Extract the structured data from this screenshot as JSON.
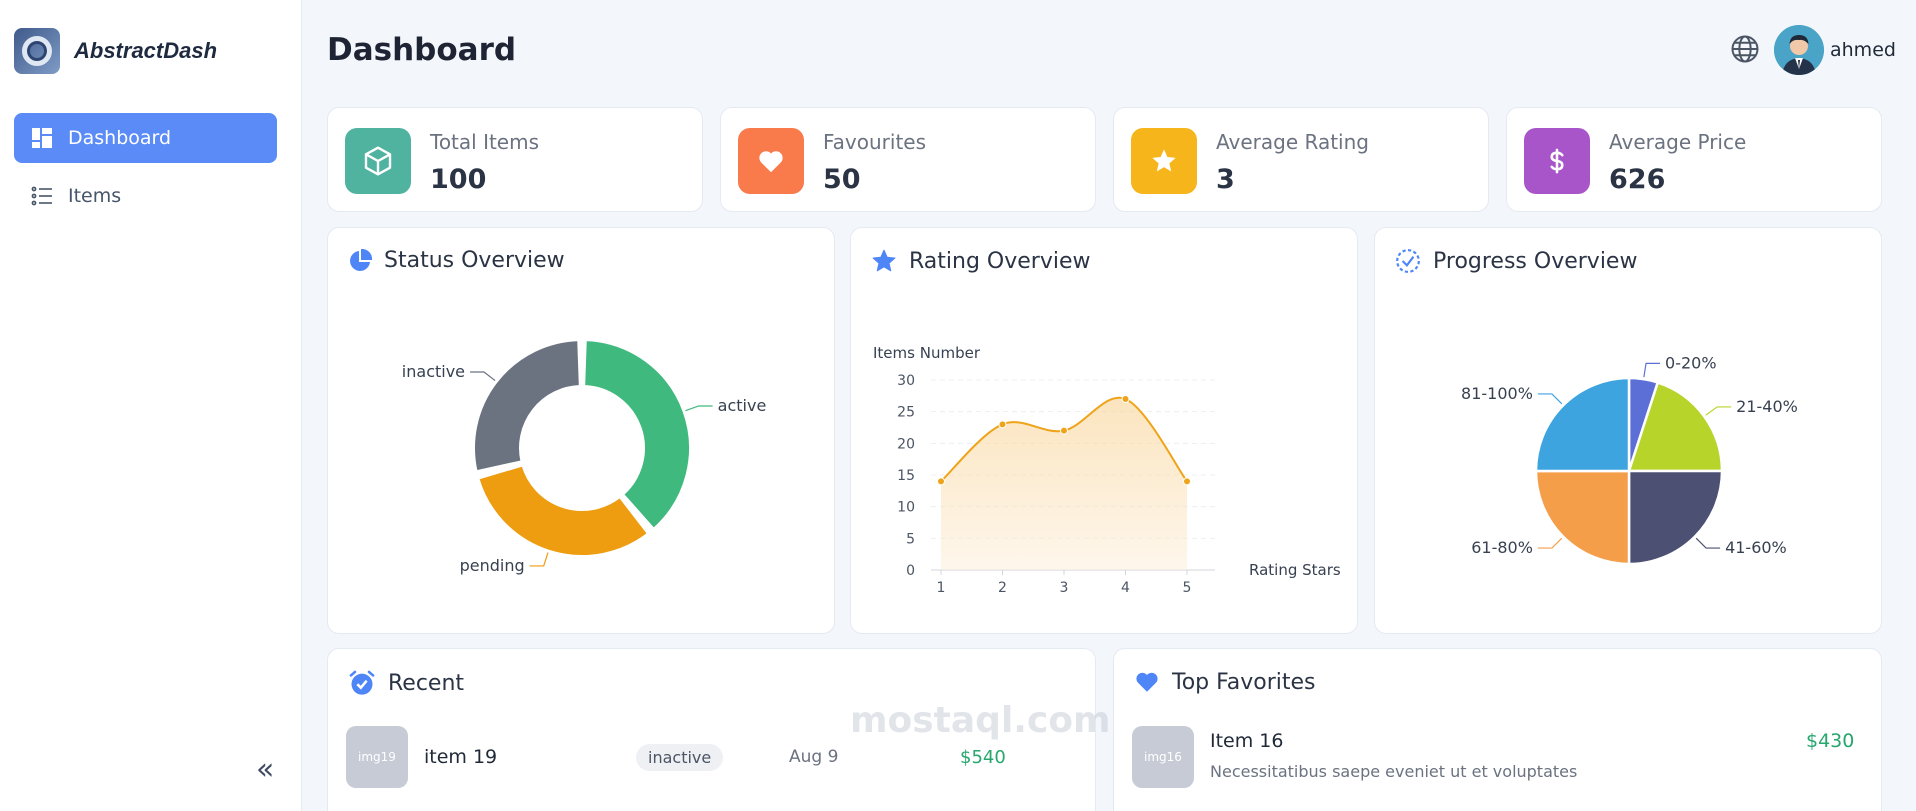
{
  "brand": {
    "name": "AbstractDash"
  },
  "sidebar": {
    "items": [
      {
        "label": "Dashboard",
        "active": true,
        "icon": "dashboard-icon"
      },
      {
        "label": "Items",
        "active": false,
        "icon": "list-icon"
      }
    ],
    "collapse_label": "«"
  },
  "header": {
    "title": "Dashboard",
    "user": "ahmed"
  },
  "stats": [
    {
      "label": "Total Items",
      "value": "100",
      "icon": "box-icon",
      "color": "#4fb3a0"
    },
    {
      "label": "Favourites",
      "value": "50",
      "icon": "heart-icon",
      "color": "#f97a4a"
    },
    {
      "label": "Average Rating",
      "value": "3",
      "icon": "star-icon",
      "color": "#f6b51a"
    },
    {
      "label": "Average Price",
      "value": "626",
      "icon": "dollar-icon",
      "color": "#a755c9"
    }
  ],
  "panels": {
    "status": {
      "title": "Status Overview"
    },
    "rating": {
      "title": "Rating Overview"
    },
    "progress": {
      "title": "Progress Overview"
    },
    "recent": {
      "title": "Recent"
    },
    "favorites": {
      "title": "Top Favorites"
    }
  },
  "chart_data": [
    {
      "type": "pie",
      "subtype": "donut",
      "categories": [
        "active",
        "pending",
        "inactive"
      ],
      "values": [
        39,
        32,
        29
      ],
      "colors": [
        "#40b97e",
        "#ee9c10",
        "#6b7280"
      ]
    },
    {
      "type": "area",
      "xlabel": "Rating Stars",
      "ylabel": "Items Number",
      "x": [
        1,
        2,
        3,
        4,
        5
      ],
      "values": [
        14,
        23,
        22,
        27,
        14
      ],
      "ylim": [
        0,
        30
      ],
      "yticks": [
        0,
        5,
        10,
        15,
        20,
        25,
        30
      ],
      "color": "#eea318",
      "grid": true
    },
    {
      "type": "pie",
      "categories": [
        "0-20%",
        "21-40%",
        "41-60%",
        "61-80%",
        "81-100%"
      ],
      "values": [
        5,
        20,
        25,
        25,
        25
      ],
      "colors": [
        "#5b6fd6",
        "#b7d42a",
        "#4c5072",
        "#f59e4a",
        "#3da4e0"
      ]
    }
  ],
  "recent": [
    {
      "thumb": "img19",
      "name": "item 19",
      "status": "inactive",
      "date": "Aug 9",
      "price": "$540"
    }
  ],
  "favorites": [
    {
      "thumb": "img16",
      "name": "Item 16",
      "desc": "Necessitatibus saepe eveniet ut et voluptates",
      "price": "$430"
    }
  ],
  "watermark": "mostaql.com"
}
